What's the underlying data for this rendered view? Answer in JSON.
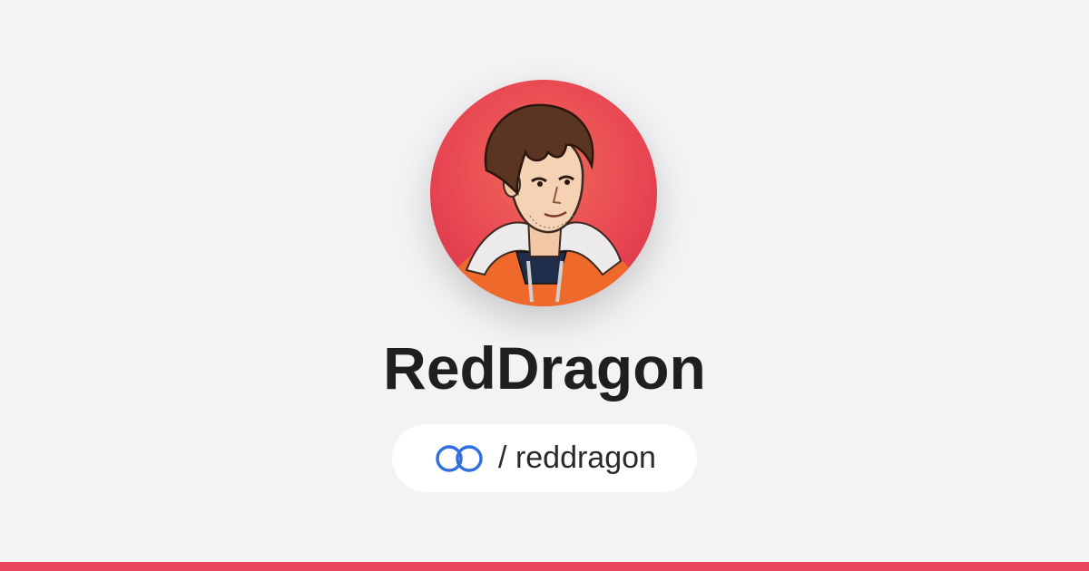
{
  "profile": {
    "name": "RedDragon",
    "handle": "/ reddragon"
  },
  "icons": {
    "logo": "linked-rings-icon",
    "avatar": "user-avatar-illustration"
  },
  "colors": {
    "background": "#f3f3f5",
    "accent_bar": "#e8445f",
    "logo_blue": "#2f6fe0",
    "avatar_bg": "#e94a4a",
    "name_text": "#1f1f1f"
  }
}
